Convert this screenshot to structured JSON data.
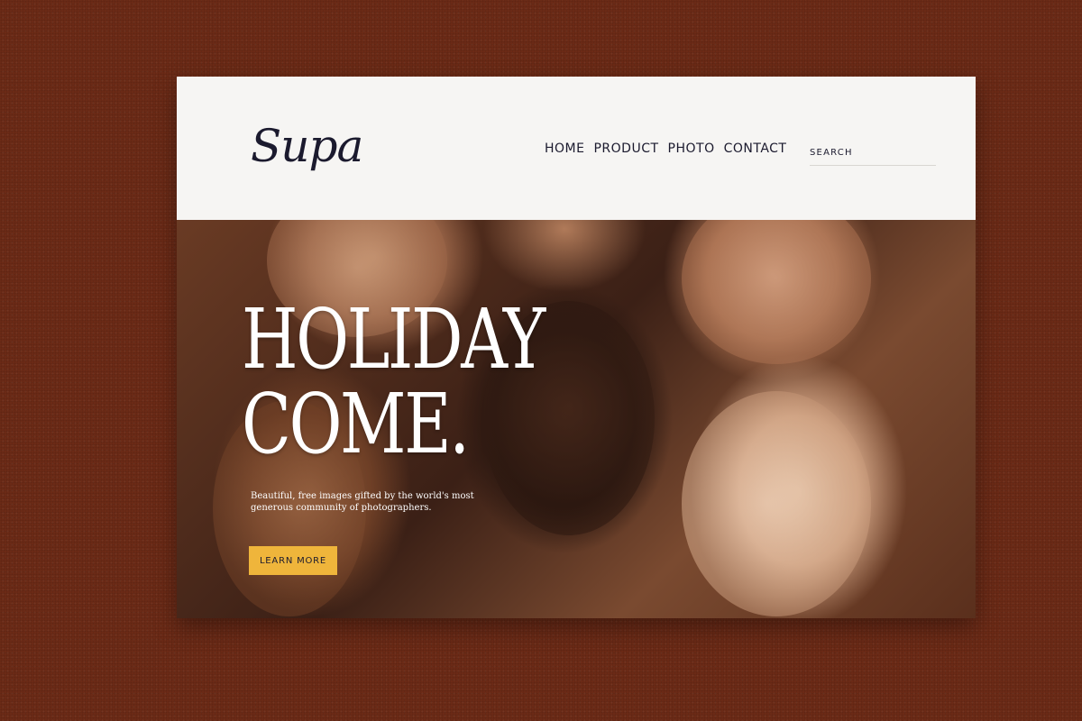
{
  "brand": {
    "logo_text": "Supa"
  },
  "nav": {
    "items": [
      {
        "label": "HOME"
      },
      {
        "label": "PRODUCT"
      },
      {
        "label": "PHOTO"
      },
      {
        "label": "CONTACT"
      }
    ]
  },
  "search": {
    "placeholder": "SEARCH"
  },
  "hero": {
    "title_line1": "HOLIDAY",
    "title_line2": "COME.",
    "subtitle": "Beautiful, free images gifted by the world's most generous community of photographers.",
    "cta_label": "LEARN MORE"
  },
  "colors": {
    "page_background": "#6b2a16",
    "header_background": "#f6f5f3",
    "text_dark": "#1b1a2e",
    "cta": "#efb53b",
    "hero_text": "#ffffff"
  }
}
